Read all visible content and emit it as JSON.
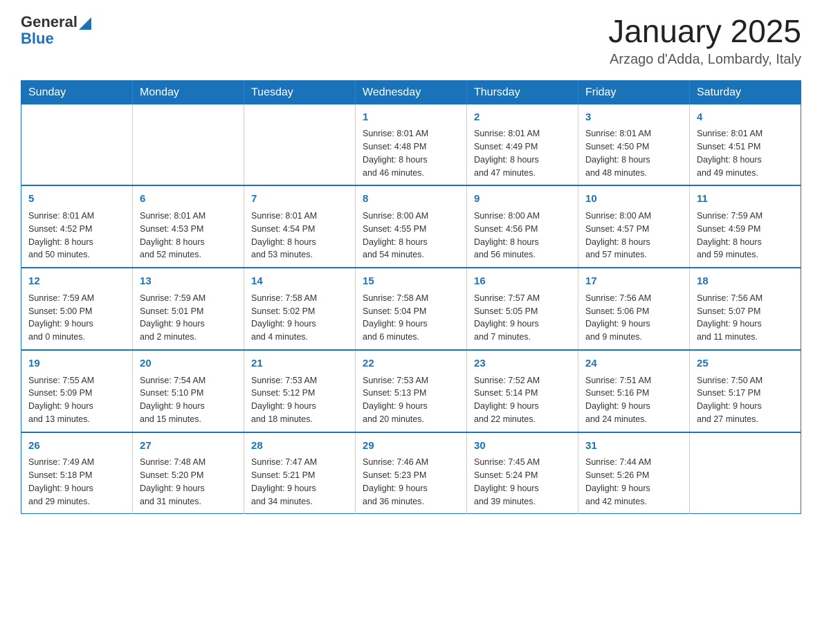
{
  "header": {
    "logo_general": "General",
    "logo_blue": "Blue",
    "month_title": "January 2025",
    "location": "Arzago d'Adda, Lombardy, Italy"
  },
  "weekdays": [
    "Sunday",
    "Monday",
    "Tuesday",
    "Wednesday",
    "Thursday",
    "Friday",
    "Saturday"
  ],
  "weeks": [
    [
      {
        "day": "",
        "info": ""
      },
      {
        "day": "",
        "info": ""
      },
      {
        "day": "",
        "info": ""
      },
      {
        "day": "1",
        "info": "Sunrise: 8:01 AM\nSunset: 4:48 PM\nDaylight: 8 hours\nand 46 minutes."
      },
      {
        "day": "2",
        "info": "Sunrise: 8:01 AM\nSunset: 4:49 PM\nDaylight: 8 hours\nand 47 minutes."
      },
      {
        "day": "3",
        "info": "Sunrise: 8:01 AM\nSunset: 4:50 PM\nDaylight: 8 hours\nand 48 minutes."
      },
      {
        "day": "4",
        "info": "Sunrise: 8:01 AM\nSunset: 4:51 PM\nDaylight: 8 hours\nand 49 minutes."
      }
    ],
    [
      {
        "day": "5",
        "info": "Sunrise: 8:01 AM\nSunset: 4:52 PM\nDaylight: 8 hours\nand 50 minutes."
      },
      {
        "day": "6",
        "info": "Sunrise: 8:01 AM\nSunset: 4:53 PM\nDaylight: 8 hours\nand 52 minutes."
      },
      {
        "day": "7",
        "info": "Sunrise: 8:01 AM\nSunset: 4:54 PM\nDaylight: 8 hours\nand 53 minutes."
      },
      {
        "day": "8",
        "info": "Sunrise: 8:00 AM\nSunset: 4:55 PM\nDaylight: 8 hours\nand 54 minutes."
      },
      {
        "day": "9",
        "info": "Sunrise: 8:00 AM\nSunset: 4:56 PM\nDaylight: 8 hours\nand 56 minutes."
      },
      {
        "day": "10",
        "info": "Sunrise: 8:00 AM\nSunset: 4:57 PM\nDaylight: 8 hours\nand 57 minutes."
      },
      {
        "day": "11",
        "info": "Sunrise: 7:59 AM\nSunset: 4:59 PM\nDaylight: 8 hours\nand 59 minutes."
      }
    ],
    [
      {
        "day": "12",
        "info": "Sunrise: 7:59 AM\nSunset: 5:00 PM\nDaylight: 9 hours\nand 0 minutes."
      },
      {
        "day": "13",
        "info": "Sunrise: 7:59 AM\nSunset: 5:01 PM\nDaylight: 9 hours\nand 2 minutes."
      },
      {
        "day": "14",
        "info": "Sunrise: 7:58 AM\nSunset: 5:02 PM\nDaylight: 9 hours\nand 4 minutes."
      },
      {
        "day": "15",
        "info": "Sunrise: 7:58 AM\nSunset: 5:04 PM\nDaylight: 9 hours\nand 6 minutes."
      },
      {
        "day": "16",
        "info": "Sunrise: 7:57 AM\nSunset: 5:05 PM\nDaylight: 9 hours\nand 7 minutes."
      },
      {
        "day": "17",
        "info": "Sunrise: 7:56 AM\nSunset: 5:06 PM\nDaylight: 9 hours\nand 9 minutes."
      },
      {
        "day": "18",
        "info": "Sunrise: 7:56 AM\nSunset: 5:07 PM\nDaylight: 9 hours\nand 11 minutes."
      }
    ],
    [
      {
        "day": "19",
        "info": "Sunrise: 7:55 AM\nSunset: 5:09 PM\nDaylight: 9 hours\nand 13 minutes."
      },
      {
        "day": "20",
        "info": "Sunrise: 7:54 AM\nSunset: 5:10 PM\nDaylight: 9 hours\nand 15 minutes."
      },
      {
        "day": "21",
        "info": "Sunrise: 7:53 AM\nSunset: 5:12 PM\nDaylight: 9 hours\nand 18 minutes."
      },
      {
        "day": "22",
        "info": "Sunrise: 7:53 AM\nSunset: 5:13 PM\nDaylight: 9 hours\nand 20 minutes."
      },
      {
        "day": "23",
        "info": "Sunrise: 7:52 AM\nSunset: 5:14 PM\nDaylight: 9 hours\nand 22 minutes."
      },
      {
        "day": "24",
        "info": "Sunrise: 7:51 AM\nSunset: 5:16 PM\nDaylight: 9 hours\nand 24 minutes."
      },
      {
        "day": "25",
        "info": "Sunrise: 7:50 AM\nSunset: 5:17 PM\nDaylight: 9 hours\nand 27 minutes."
      }
    ],
    [
      {
        "day": "26",
        "info": "Sunrise: 7:49 AM\nSunset: 5:18 PM\nDaylight: 9 hours\nand 29 minutes."
      },
      {
        "day": "27",
        "info": "Sunrise: 7:48 AM\nSunset: 5:20 PM\nDaylight: 9 hours\nand 31 minutes."
      },
      {
        "day": "28",
        "info": "Sunrise: 7:47 AM\nSunset: 5:21 PM\nDaylight: 9 hours\nand 34 minutes."
      },
      {
        "day": "29",
        "info": "Sunrise: 7:46 AM\nSunset: 5:23 PM\nDaylight: 9 hours\nand 36 minutes."
      },
      {
        "day": "30",
        "info": "Sunrise: 7:45 AM\nSunset: 5:24 PM\nDaylight: 9 hours\nand 39 minutes."
      },
      {
        "day": "31",
        "info": "Sunrise: 7:44 AM\nSunset: 5:26 PM\nDaylight: 9 hours\nand 42 minutes."
      },
      {
        "day": "",
        "info": ""
      }
    ]
  ]
}
